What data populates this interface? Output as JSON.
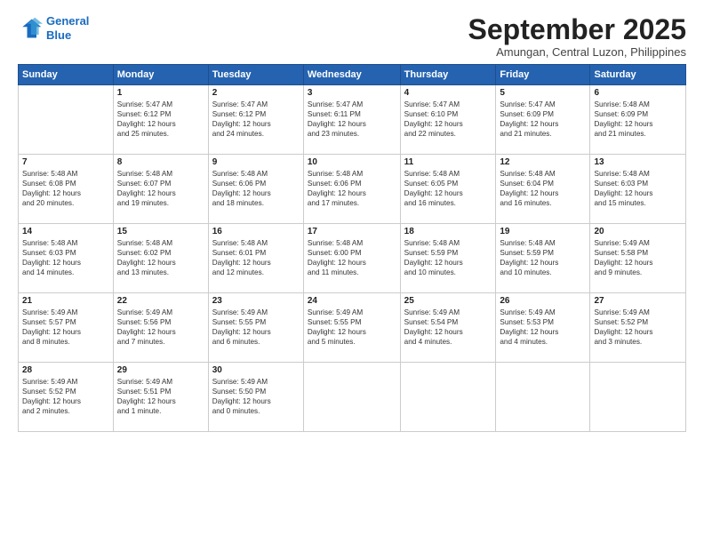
{
  "logo": {
    "line1": "General",
    "line2": "Blue"
  },
  "title": "September 2025",
  "location": "Amungan, Central Luzon, Philippines",
  "days_header": [
    "Sunday",
    "Monday",
    "Tuesday",
    "Wednesday",
    "Thursday",
    "Friday",
    "Saturday"
  ],
  "weeks": [
    [
      {
        "day": "",
        "info": ""
      },
      {
        "day": "1",
        "info": "Sunrise: 5:47 AM\nSunset: 6:12 PM\nDaylight: 12 hours\nand 25 minutes."
      },
      {
        "day": "2",
        "info": "Sunrise: 5:47 AM\nSunset: 6:12 PM\nDaylight: 12 hours\nand 24 minutes."
      },
      {
        "day": "3",
        "info": "Sunrise: 5:47 AM\nSunset: 6:11 PM\nDaylight: 12 hours\nand 23 minutes."
      },
      {
        "day": "4",
        "info": "Sunrise: 5:47 AM\nSunset: 6:10 PM\nDaylight: 12 hours\nand 22 minutes."
      },
      {
        "day": "5",
        "info": "Sunrise: 5:47 AM\nSunset: 6:09 PM\nDaylight: 12 hours\nand 21 minutes."
      },
      {
        "day": "6",
        "info": "Sunrise: 5:48 AM\nSunset: 6:09 PM\nDaylight: 12 hours\nand 21 minutes."
      }
    ],
    [
      {
        "day": "7",
        "info": "Sunrise: 5:48 AM\nSunset: 6:08 PM\nDaylight: 12 hours\nand 20 minutes."
      },
      {
        "day": "8",
        "info": "Sunrise: 5:48 AM\nSunset: 6:07 PM\nDaylight: 12 hours\nand 19 minutes."
      },
      {
        "day": "9",
        "info": "Sunrise: 5:48 AM\nSunset: 6:06 PM\nDaylight: 12 hours\nand 18 minutes."
      },
      {
        "day": "10",
        "info": "Sunrise: 5:48 AM\nSunset: 6:06 PM\nDaylight: 12 hours\nand 17 minutes."
      },
      {
        "day": "11",
        "info": "Sunrise: 5:48 AM\nSunset: 6:05 PM\nDaylight: 12 hours\nand 16 minutes."
      },
      {
        "day": "12",
        "info": "Sunrise: 5:48 AM\nSunset: 6:04 PM\nDaylight: 12 hours\nand 16 minutes."
      },
      {
        "day": "13",
        "info": "Sunrise: 5:48 AM\nSunset: 6:03 PM\nDaylight: 12 hours\nand 15 minutes."
      }
    ],
    [
      {
        "day": "14",
        "info": "Sunrise: 5:48 AM\nSunset: 6:03 PM\nDaylight: 12 hours\nand 14 minutes."
      },
      {
        "day": "15",
        "info": "Sunrise: 5:48 AM\nSunset: 6:02 PM\nDaylight: 12 hours\nand 13 minutes."
      },
      {
        "day": "16",
        "info": "Sunrise: 5:48 AM\nSunset: 6:01 PM\nDaylight: 12 hours\nand 12 minutes."
      },
      {
        "day": "17",
        "info": "Sunrise: 5:48 AM\nSunset: 6:00 PM\nDaylight: 12 hours\nand 11 minutes."
      },
      {
        "day": "18",
        "info": "Sunrise: 5:48 AM\nSunset: 5:59 PM\nDaylight: 12 hours\nand 10 minutes."
      },
      {
        "day": "19",
        "info": "Sunrise: 5:48 AM\nSunset: 5:59 PM\nDaylight: 12 hours\nand 10 minutes."
      },
      {
        "day": "20",
        "info": "Sunrise: 5:49 AM\nSunset: 5:58 PM\nDaylight: 12 hours\nand 9 minutes."
      }
    ],
    [
      {
        "day": "21",
        "info": "Sunrise: 5:49 AM\nSunset: 5:57 PM\nDaylight: 12 hours\nand 8 minutes."
      },
      {
        "day": "22",
        "info": "Sunrise: 5:49 AM\nSunset: 5:56 PM\nDaylight: 12 hours\nand 7 minutes."
      },
      {
        "day": "23",
        "info": "Sunrise: 5:49 AM\nSunset: 5:55 PM\nDaylight: 12 hours\nand 6 minutes."
      },
      {
        "day": "24",
        "info": "Sunrise: 5:49 AM\nSunset: 5:55 PM\nDaylight: 12 hours\nand 5 minutes."
      },
      {
        "day": "25",
        "info": "Sunrise: 5:49 AM\nSunset: 5:54 PM\nDaylight: 12 hours\nand 4 minutes."
      },
      {
        "day": "26",
        "info": "Sunrise: 5:49 AM\nSunset: 5:53 PM\nDaylight: 12 hours\nand 4 minutes."
      },
      {
        "day": "27",
        "info": "Sunrise: 5:49 AM\nSunset: 5:52 PM\nDaylight: 12 hours\nand 3 minutes."
      }
    ],
    [
      {
        "day": "28",
        "info": "Sunrise: 5:49 AM\nSunset: 5:52 PM\nDaylight: 12 hours\nand 2 minutes."
      },
      {
        "day": "29",
        "info": "Sunrise: 5:49 AM\nSunset: 5:51 PM\nDaylight: 12 hours\nand 1 minute."
      },
      {
        "day": "30",
        "info": "Sunrise: 5:49 AM\nSunset: 5:50 PM\nDaylight: 12 hours\nand 0 minutes."
      },
      {
        "day": "",
        "info": ""
      },
      {
        "day": "",
        "info": ""
      },
      {
        "day": "",
        "info": ""
      },
      {
        "day": "",
        "info": ""
      }
    ]
  ]
}
